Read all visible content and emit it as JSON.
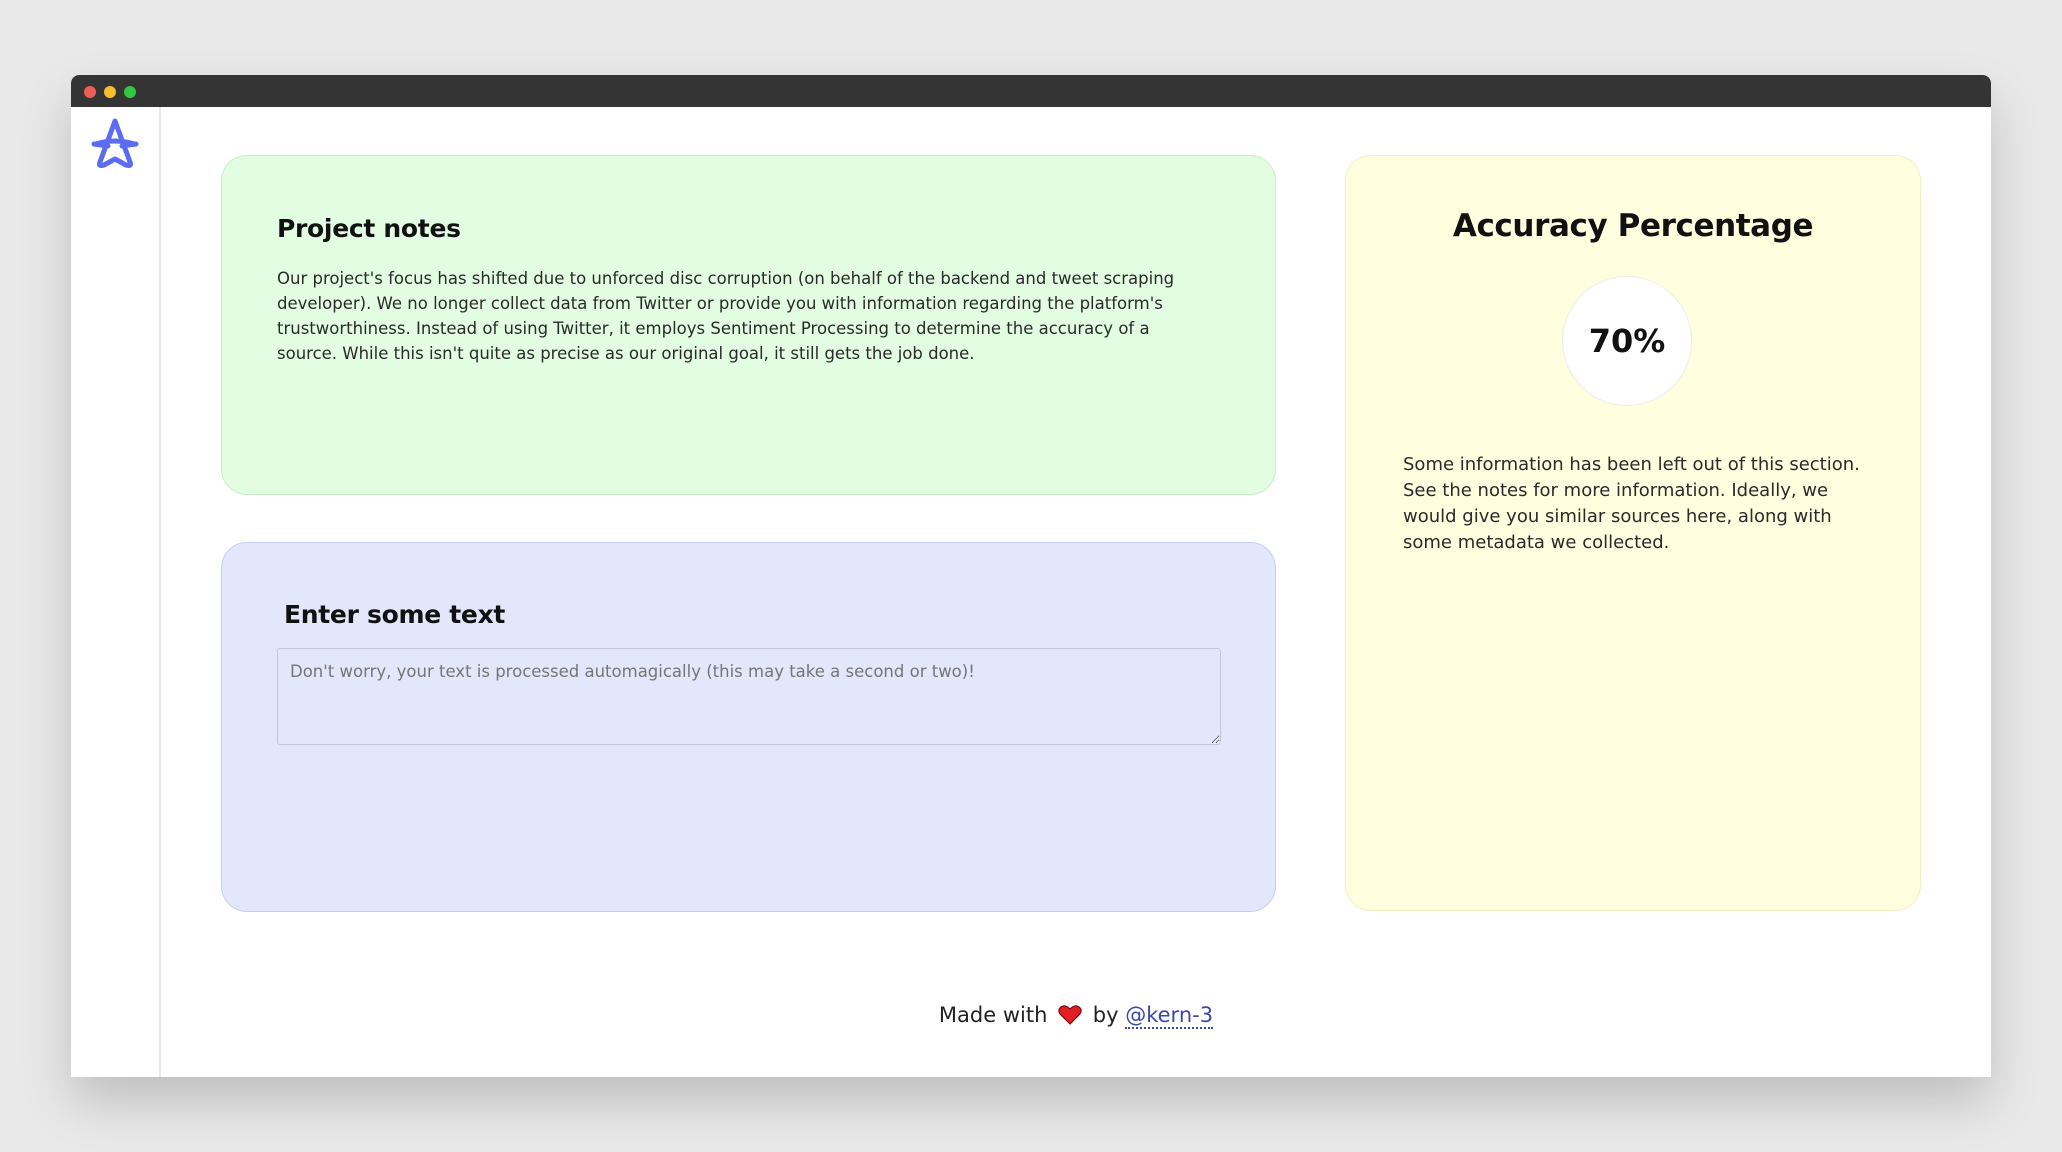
{
  "colors": {
    "notes_bg": "#e2fde2",
    "text_bg": "#e3e7fb",
    "accuracy_bg": "#ffffe0",
    "logo": "#5b6cf2",
    "link": "#3949ab",
    "heart": "#e01e24"
  },
  "sidebar": {
    "logo_icon": "star-a-logo-icon"
  },
  "notes": {
    "title": "Project notes",
    "body": "Our project's focus has shifted due to unforced disc corruption (on behalf of the backend and tweet scraping developer). We no longer collect data from Twitter or provide you with information regarding the platform's trustworthiness. Instead of using Twitter, it employs Sentiment Processing to determine the accuracy of a source. While this isn't quite as precise as our original goal, it still gets the job done."
  },
  "input": {
    "title": "Enter some text",
    "placeholder": "Don't worry, your text is processed automagically (this may take a second or two)!",
    "value": ""
  },
  "accuracy": {
    "title": "Accuracy Percentage",
    "value": "70%",
    "body": "Some information has been left out of this section. See the notes for more information. Ideally, we would give you similar sources here, along with some metadata we collected."
  },
  "footer": {
    "made_with": "Made with",
    "by": "by",
    "author": "@kern-3",
    "heart_icon": "heart-icon"
  }
}
